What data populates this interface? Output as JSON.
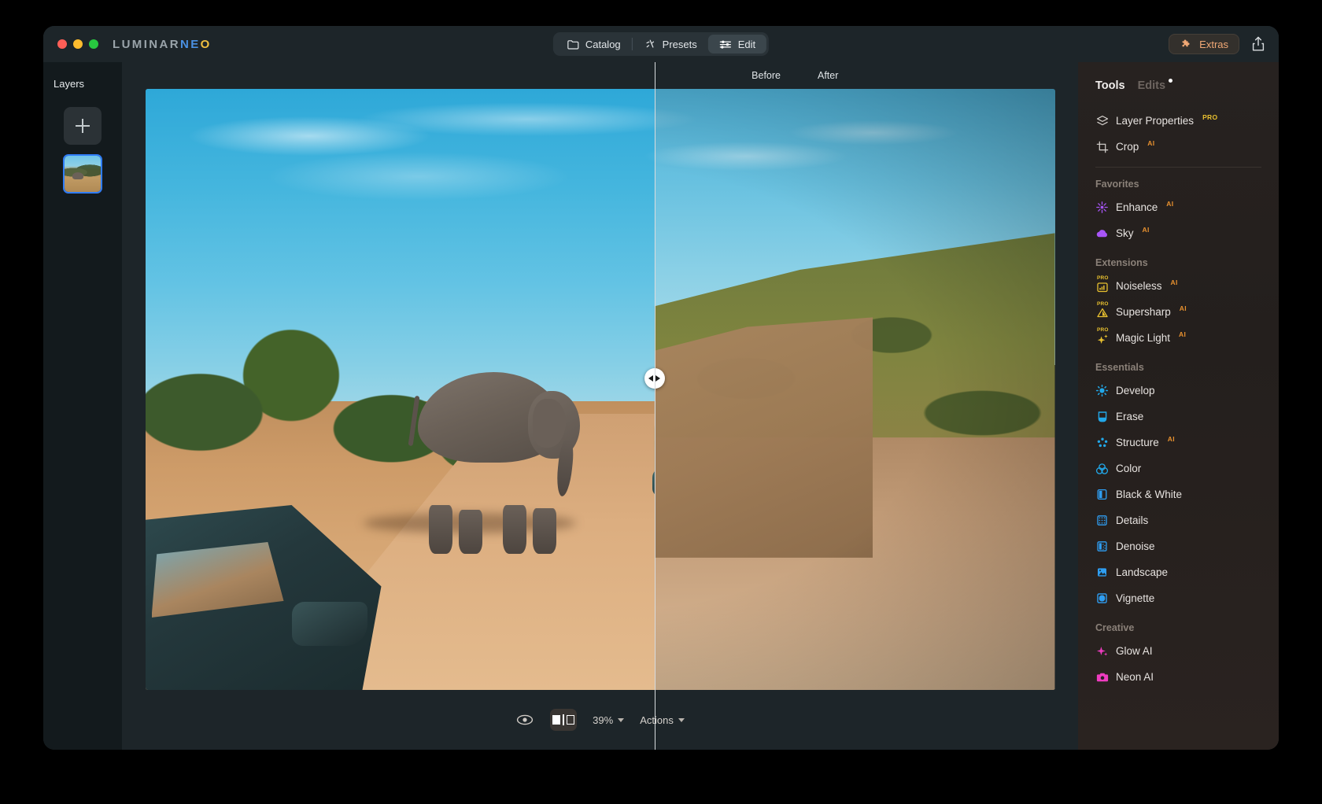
{
  "app": {
    "brand_main": "LUMINAR",
    "brand_accent": "NE",
    "brand_accent_o": "O",
    "window_controls": [
      "close",
      "minimize",
      "maximize"
    ]
  },
  "header": {
    "tabs": [
      {
        "id": "catalog",
        "label": "Catalog",
        "icon": "folder-icon",
        "active": false
      },
      {
        "id": "presets",
        "label": "Presets",
        "icon": "sparkle-icon",
        "active": false
      },
      {
        "id": "edit",
        "label": "Edit",
        "icon": "sliders-icon",
        "active": true
      }
    ],
    "extras_label": "Extras",
    "extras_icon": "puzzle-icon",
    "share_icon": "share-icon"
  },
  "layers": {
    "title": "Layers",
    "add_button_label": "+",
    "items": [
      {
        "id": "layer-1",
        "selected": true
      }
    ]
  },
  "canvas": {
    "before_label": "Before",
    "after_label": "After",
    "split_position_percent": 56,
    "split_handle_icon": "left-right-arrows-icon"
  },
  "bottom_bar": {
    "eye_icon": "eye-icon",
    "compare_icon": "before-after-split-icon",
    "compare_active": true,
    "zoom_value": "39%",
    "actions_label": "Actions",
    "chevron_icon": "chevron-down-icon"
  },
  "tools_panel": {
    "tabs": [
      {
        "id": "tools",
        "label": "Tools",
        "active": true,
        "has_dot": false
      },
      {
        "id": "edits",
        "label": "Edits",
        "active": false,
        "has_dot": true
      }
    ],
    "top_items": [
      {
        "id": "layer-properties",
        "label": "Layer Properties",
        "icon": "layers-icon",
        "badge": "PRO",
        "badge_type": "pro",
        "color": "#d8d4d0"
      },
      {
        "id": "crop",
        "label": "Crop",
        "icon": "crop-icon",
        "badge": "AI",
        "badge_type": "ai",
        "color": "#d8d4d0"
      }
    ],
    "sections": [
      {
        "id": "favorites",
        "title": "Favorites",
        "items": [
          {
            "id": "enhance",
            "label": "Enhance",
            "icon": "enhance-burst-icon",
            "badge": "AI",
            "badge_type": "ai",
            "color": "#a855f7",
            "icon_pro": false
          },
          {
            "id": "sky",
            "label": "Sky",
            "icon": "cloud-icon",
            "badge": "AI",
            "badge_type": "ai",
            "color": "#a855f7",
            "icon_pro": false
          }
        ]
      },
      {
        "id": "extensions",
        "title": "Extensions",
        "items": [
          {
            "id": "noiseless",
            "label": "Noiseless",
            "icon": "noiseless-chart-icon",
            "badge": "AI",
            "badge_type": "ai",
            "color": "#e8c02f",
            "icon_pro": true
          },
          {
            "id": "supersharp",
            "label": "Supersharp",
            "icon": "triangle-icon",
            "badge": "AI",
            "badge_type": "ai",
            "color": "#e8c02f",
            "icon_pro": true
          },
          {
            "id": "magic-light",
            "label": "Magic Light",
            "icon": "sparkles-icon",
            "badge": "AI",
            "badge_type": "ai",
            "color": "#e8c02f",
            "icon_pro": true
          }
        ]
      },
      {
        "id": "essentials",
        "title": "Essentials",
        "items": [
          {
            "id": "develop",
            "label": "Develop",
            "icon": "sun-icon",
            "badge": "",
            "badge_type": "",
            "color": "#22a7e8",
            "icon_pro": false
          },
          {
            "id": "erase",
            "label": "Erase",
            "icon": "eraser-icon",
            "badge": "",
            "badge_type": "",
            "color": "#22a7e8",
            "icon_pro": false
          },
          {
            "id": "structure",
            "label": "Structure",
            "icon": "dots-grid-icon",
            "badge": "AI",
            "badge_type": "ai",
            "color": "#22a7e8",
            "icon_pro": false
          },
          {
            "id": "color",
            "label": "Color",
            "icon": "color-circles-icon",
            "badge": "",
            "badge_type": "",
            "color": "#22a7e8",
            "icon_pro": false
          },
          {
            "id": "black-and-white",
            "label": "Black & White",
            "icon": "half-square-icon",
            "badge": "",
            "badge_type": "",
            "color": "#2f9ef2",
            "icon_pro": false
          },
          {
            "id": "details",
            "label": "Details",
            "icon": "halftone-square-icon",
            "badge": "",
            "badge_type": "",
            "color": "#2f9ef2",
            "icon_pro": false
          },
          {
            "id": "denoise",
            "label": "Denoise",
            "icon": "noise-square-icon",
            "badge": "",
            "badge_type": "",
            "color": "#2f9ef2",
            "icon_pro": false
          },
          {
            "id": "landscape",
            "label": "Landscape",
            "icon": "mountain-photo-icon",
            "badge": "",
            "badge_type": "",
            "color": "#2f9ef2",
            "icon_pro": false
          },
          {
            "id": "vignette",
            "label": "Vignette",
            "icon": "rounded-square-icon",
            "badge": "",
            "badge_type": "",
            "color": "#2f9ef2",
            "icon_pro": false
          }
        ]
      },
      {
        "id": "creative",
        "title": "Creative",
        "items": [
          {
            "id": "glow-ai",
            "label": "Glow AI",
            "icon": "sparkle-star-icon",
            "badge": "",
            "badge_type": "",
            "color": "#ef3cc0",
            "icon_pro": false
          },
          {
            "id": "neon-ai",
            "label": "Neon AI",
            "icon": "camera-icon",
            "badge": "",
            "badge_type": "",
            "color": "#ef3cc0",
            "icon_pro": false
          }
        ]
      }
    ]
  },
  "colors": {
    "accent_extras": "#f0a875",
    "accent_pro": "#e8c02f",
    "accent_ai": "#e8912f",
    "layer_selected": "#2f7cf6",
    "favorites": "#a855f7",
    "essentials": "#22a7e8",
    "creative": "#ef3cc0"
  }
}
